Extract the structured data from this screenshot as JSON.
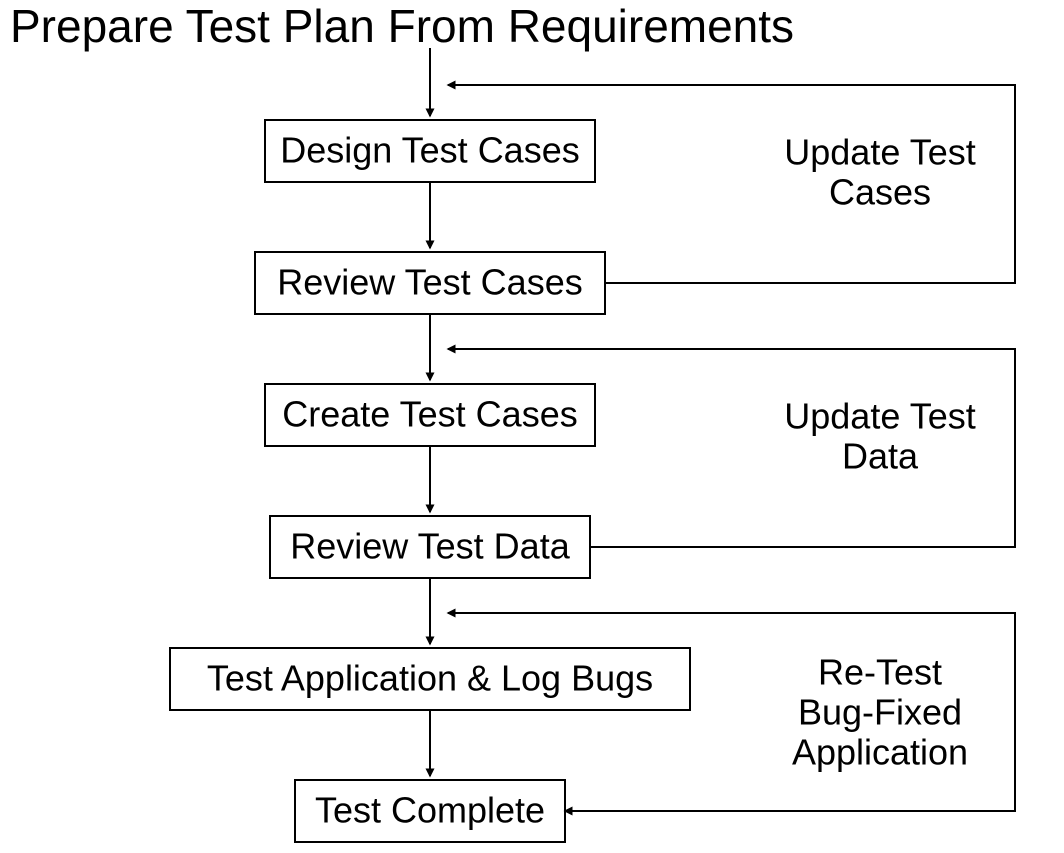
{
  "title": "Prepare Test Plan From Requirements",
  "boxes": {
    "design": "Design Test Cases",
    "review_cases": "Review Test Cases",
    "create": "Create Test Cases",
    "review_data": "Review Test Data",
    "test_app": "Test Application & Log Bugs",
    "complete": "Test Complete"
  },
  "feedback": {
    "update_cases_l1": "Update Test",
    "update_cases_l2": "Cases",
    "update_data_l1": "Update Test",
    "update_data_l2": "Data",
    "retest_l1": "Re-Test",
    "retest_l2": "Bug-Fixed",
    "retest_l3": "Application"
  }
}
